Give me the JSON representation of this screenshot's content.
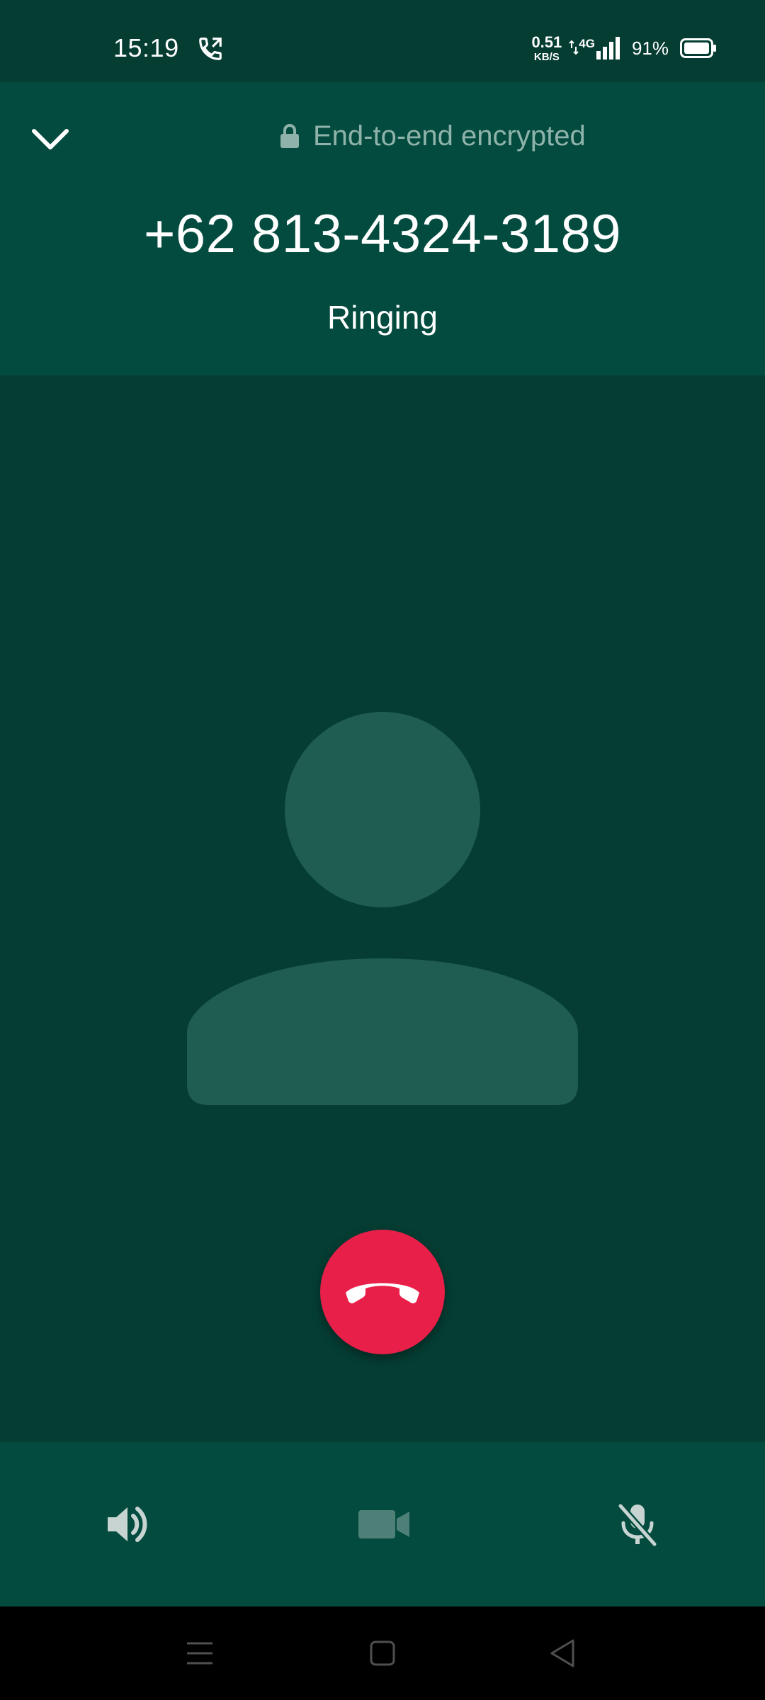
{
  "status_bar": {
    "time": "15:19",
    "call_icon": "wifi-call-icon",
    "net_speed_value": "0.51",
    "net_speed_unit": "KB/S",
    "network_type": "4G",
    "battery_percent": "91%"
  },
  "header": {
    "collapse_icon": "chevron-down-icon",
    "encryption_text": "End-to-end encrypted",
    "caller_number": "+62 813-4324-3189",
    "call_status": "Ringing"
  },
  "avatar": {
    "icon": "default-person-avatar"
  },
  "end_call": {
    "icon": "phone-hangup-icon",
    "color": "#e81f48"
  },
  "controls": {
    "speaker_icon": "speaker-icon",
    "video_icon": "video-camera-icon",
    "mute_icon": "microphone-off-icon"
  },
  "nav": {
    "recents_icon": "menu-icon",
    "home_icon": "home-icon",
    "back_icon": "back-icon"
  },
  "colors": {
    "background": "#053d33",
    "header_bg": "#024b3e",
    "accent_text": "#8fb3aa",
    "avatar": "#1f5c51"
  }
}
